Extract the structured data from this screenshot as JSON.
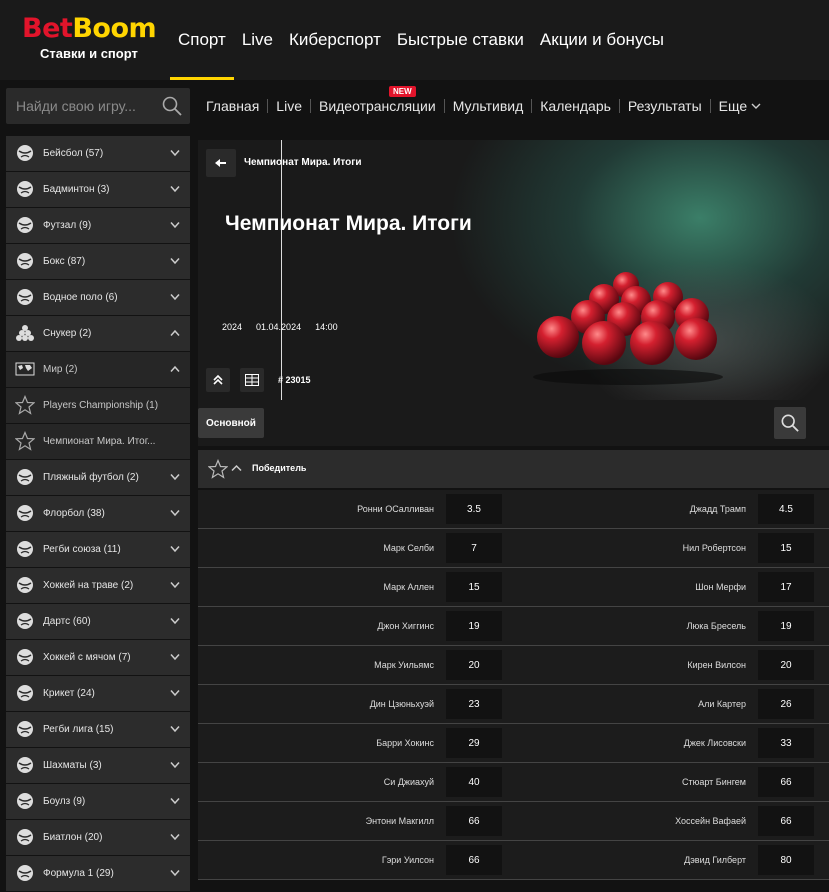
{
  "logo": {
    "part1": "Bet",
    "part2": "Boom",
    "tagline": "Ставки и спорт"
  },
  "topnav": [
    "Спорт",
    "Live",
    "Киберспорт",
    "Быстрые ставки",
    "Акции и бонусы"
  ],
  "search": {
    "placeholder": "Найди свою игру..."
  },
  "subnav": {
    "items": [
      "Главная",
      "Live",
      "Видеотрансляции",
      "Мультивид",
      "Календарь",
      "Результаты",
      "Еще"
    ],
    "badge": "NEW"
  },
  "sidebar": {
    "items": [
      {
        "label": "Бейсбол (57)",
        "icon": "baseball-icon",
        "expanded": false
      },
      {
        "label": "Бадминтон (3)",
        "icon": "shuttlecock-icon",
        "expanded": false
      },
      {
        "label": "Футзал (9)",
        "icon": "futsal-ball-icon",
        "expanded": false
      },
      {
        "label": "Бокс (87)",
        "icon": "boxing-glove-icon",
        "expanded": false
      },
      {
        "label": "Водное поло (6)",
        "icon": "waterpolo-icon",
        "expanded": false
      },
      {
        "label": "Снукер (2)",
        "icon": "snooker-icon",
        "expanded": true
      },
      {
        "label": "Мир (2)",
        "icon": "world-map-icon",
        "expanded": true,
        "sub": true
      },
      {
        "label": "Players Championship (1)",
        "icon": "star-icon",
        "sub": true,
        "leaf": true
      },
      {
        "label": "Чемпионат Мира. Итог...",
        "icon": "star-icon",
        "sub": true,
        "leaf": true,
        "active": true
      },
      {
        "label": "Пляжный футбол (2)",
        "icon": "beach-soccer-icon",
        "expanded": false
      },
      {
        "label": "Флорбол (38)",
        "icon": "floorball-icon",
        "expanded": false
      },
      {
        "label": "Регби союза (11)",
        "icon": "rugby-ball-icon",
        "expanded": false
      },
      {
        "label": "Хоккей на траве (2)",
        "icon": "field-hockey-icon",
        "expanded": false
      },
      {
        "label": "Дартс (60)",
        "icon": "darts-target-icon",
        "expanded": false
      },
      {
        "label": "Хоккей с мячом (7)",
        "icon": "bandy-icon",
        "expanded": false
      },
      {
        "label": "Крикет (24)",
        "icon": "cricket-icon",
        "expanded": false
      },
      {
        "label": "Регби лига (15)",
        "icon": "rugby-league-icon",
        "expanded": false
      },
      {
        "label": "Шахматы (3)",
        "icon": "chess-knight-icon",
        "expanded": false
      },
      {
        "label": "Боулз (9)",
        "icon": "bowls-icon",
        "expanded": false
      },
      {
        "label": "Биатлон (20)",
        "icon": "biathlon-icon",
        "expanded": false
      },
      {
        "label": "Формула 1 (29)",
        "icon": "formula1-icon",
        "expanded": false
      }
    ]
  },
  "hero": {
    "breadcrumb": "Чемпионат Мира. Итоги",
    "title": "Чемпионат Мира. Итоги",
    "year": "2024",
    "date": "01.04.2024",
    "time": "14:00",
    "event_id": "# 23015"
  },
  "tabs": {
    "main": "Основной"
  },
  "market": {
    "title": "Победитель"
  },
  "odds": [
    [
      "Ронни ОСалливан",
      "3.5",
      "Джадд Трамп",
      "4.5"
    ],
    [
      "Марк Селби",
      "7",
      "Нил Робертсон",
      "15"
    ],
    [
      "Марк Аллен",
      "15",
      "Шон Мерфи",
      "17"
    ],
    [
      "Джон Хиггинс",
      "19",
      "Люка Бресель",
      "19"
    ],
    [
      "Марк Уильямс",
      "20",
      "Кирен Вилсон",
      "20"
    ],
    [
      "Дин Цзюньхуэй",
      "23",
      "Али Картер",
      "26"
    ],
    [
      "Барри Хокинс",
      "29",
      "Джек Лисовски",
      "33"
    ],
    [
      "Си Джиахуй",
      "40",
      "Стюарт Бингем",
      "66"
    ],
    [
      "Энтони Макгилл",
      "66",
      "Хоссейн Вафаей",
      "66"
    ],
    [
      "Гэри Уилсон",
      "66",
      "Дэвид Гилберт",
      "80"
    ]
  ],
  "colors": {
    "accent": "#ffd500",
    "brand_red": "#e2142b",
    "bg": "#121212",
    "panel": "#2c2c2c"
  }
}
